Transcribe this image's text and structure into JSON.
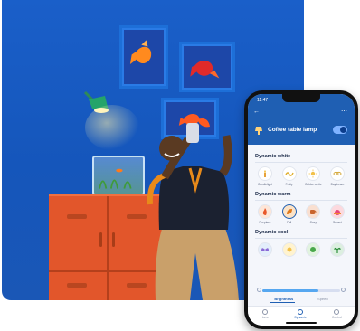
{
  "phone": {
    "status_time": "11:47",
    "device_name": "Coffee table lamp",
    "toggle_on": true,
    "sections": [
      {
        "title": "Dynamic white",
        "scenes": [
          {
            "label": "Candlelight",
            "icon": "candle-icon"
          },
          {
            "label": "Fruity",
            "icon": "wave-icon"
          },
          {
            "label": "Golden white",
            "icon": "sun-icon"
          },
          {
            "label": "Daydream",
            "icon": "chain-icon"
          }
        ]
      },
      {
        "title": "Dynamic warm",
        "scenes": [
          {
            "label": "Fireplace",
            "icon": "flame-icon"
          },
          {
            "label": "Fall",
            "icon": "leaf-icon",
            "selected": true
          },
          {
            "label": "Cozy",
            "icon": "mug-icon"
          },
          {
            "label": "Sunset",
            "icon": "sunset-icon"
          }
        ]
      },
      {
        "title": "Dynamic cool",
        "scenes": [
          {
            "label": "",
            "icon": "butterfly-icon"
          },
          {
            "label": "",
            "icon": "spark-icon"
          },
          {
            "label": "",
            "icon": "bush-icon"
          },
          {
            "label": "",
            "icon": "plant-icon"
          }
        ]
      }
    ],
    "brightness_level": 0.72,
    "segments": {
      "left": "Brightness",
      "right": "Speed"
    },
    "nav": {
      "home": "Home",
      "dynamic": "Dynamic",
      "control": "Control"
    },
    "colors": {
      "header": "#1f5fb3",
      "accent": "#1f5fb3",
      "slider": "#56a7f0"
    }
  }
}
